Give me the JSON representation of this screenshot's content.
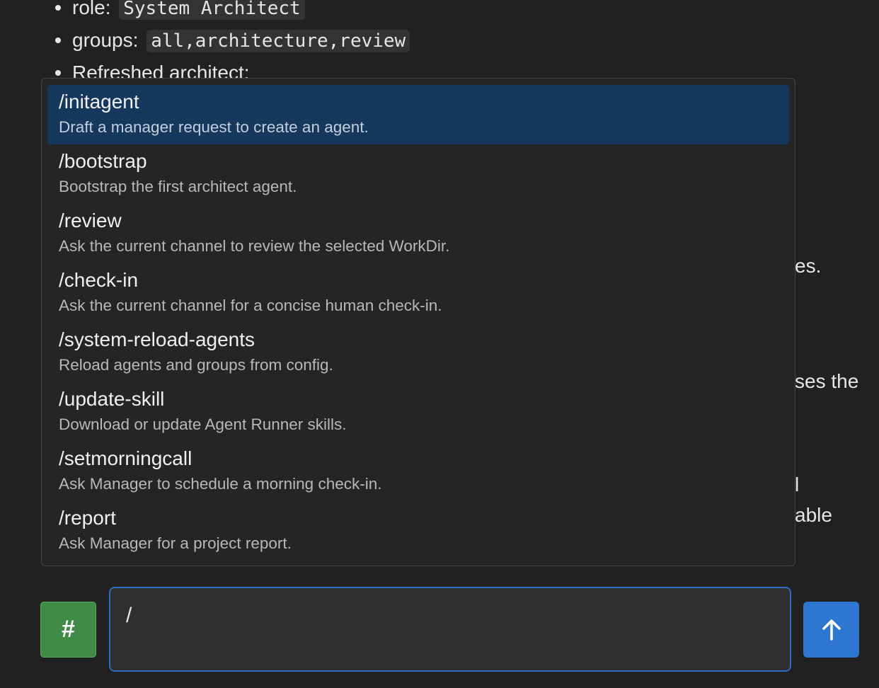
{
  "chat": {
    "bullets": [
      {
        "label": "role:",
        "code": "System Architect"
      },
      {
        "label": "groups:",
        "code": "all,architecture,review"
      },
      {
        "label": "Refreshed architect:",
        "code": ""
      }
    ],
    "fragments": [
      "es.",
      "ses the",
      "l",
      "able"
    ]
  },
  "menu": {
    "items": [
      {
        "command": "/initagent",
        "description": "Draft a manager request to create an agent."
      },
      {
        "command": "/bootstrap",
        "description": "Bootstrap the first architect agent."
      },
      {
        "command": "/review",
        "description": "Ask the current channel to review the selected WorkDir."
      },
      {
        "command": "/check-in",
        "description": "Ask the current channel for a concise human check-in."
      },
      {
        "command": "/system-reload-agents",
        "description": "Reload agents and groups from config."
      },
      {
        "command": "/update-skill",
        "description": "Download or update Agent Runner skills."
      },
      {
        "command": "/setmorningcall",
        "description": "Ask Manager to schedule a morning check-in."
      },
      {
        "command": "/report",
        "description": "Ask Manager for a project report."
      }
    ],
    "selected_index": 0
  },
  "composer": {
    "channel_label": "#",
    "input_value": "/",
    "send_icon": "arrow-up-icon"
  },
  "colors": {
    "background": "#212121",
    "menu_selected": "#16385c",
    "channel_button": "#3f8a45",
    "send_button": "#2e77d0",
    "input_border": "#2f6dc2"
  }
}
